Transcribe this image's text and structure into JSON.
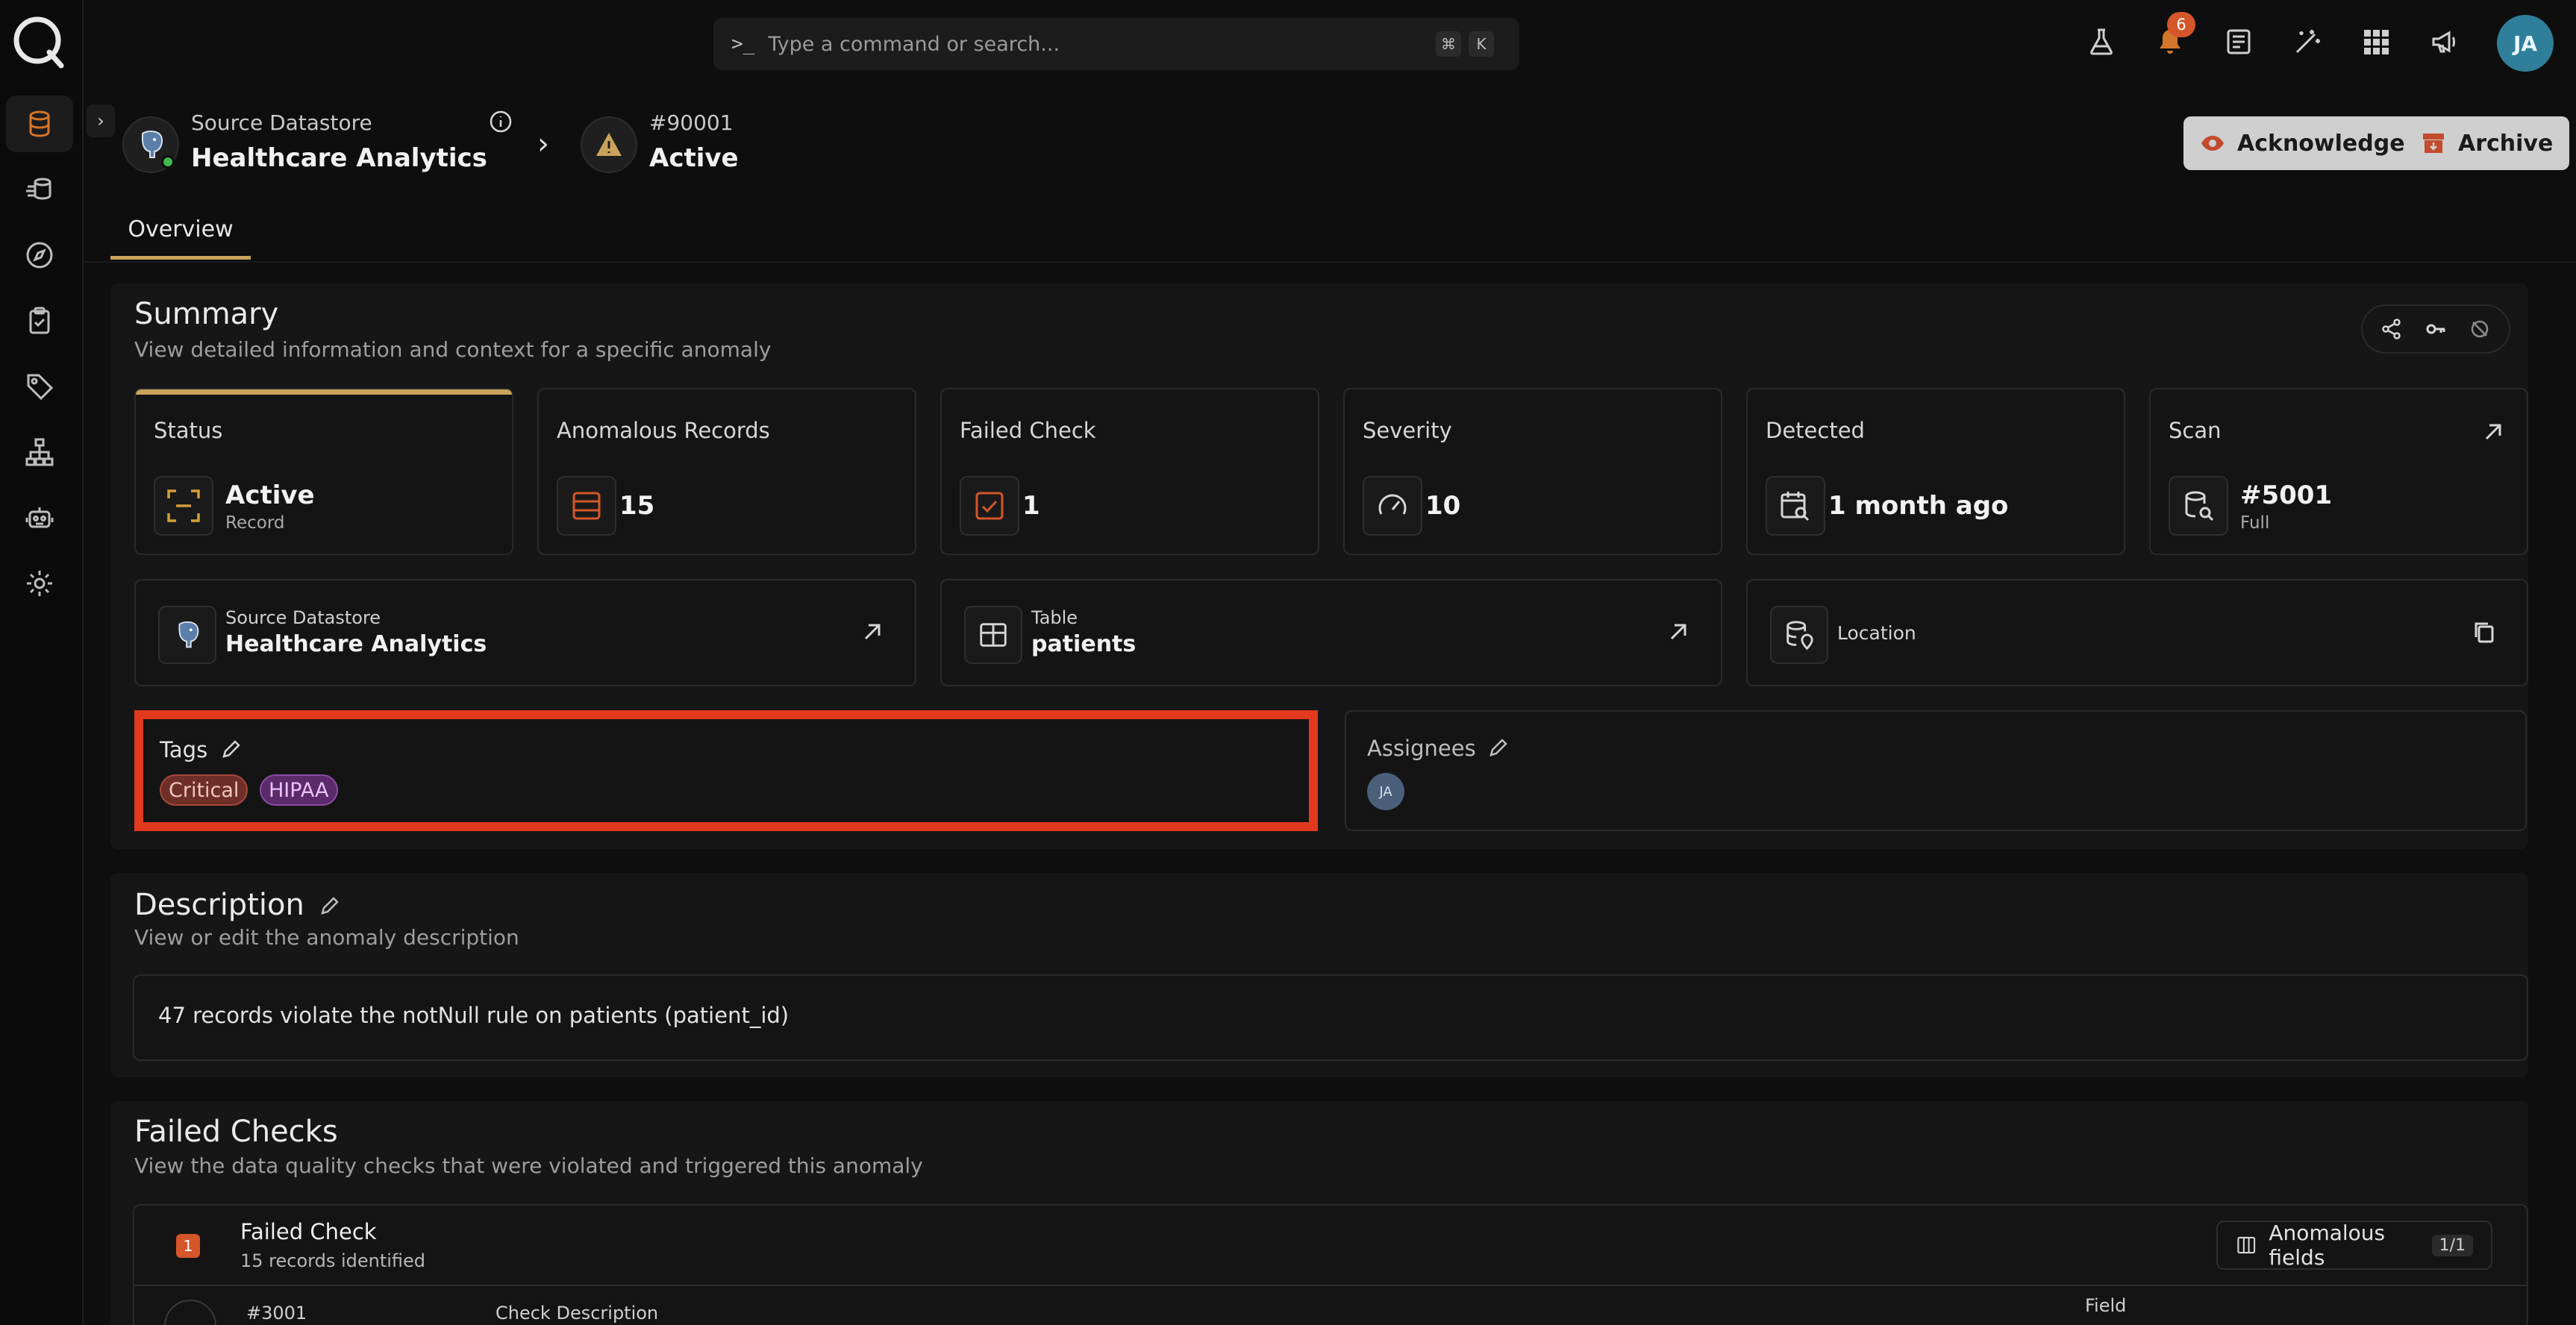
{
  "topbar": {
    "search_placeholder": "Type a command or search...",
    "shortcut_keys": [
      "⌘",
      "K"
    ],
    "notification_count": "6",
    "user_initials": "JA"
  },
  "breadcrumb": {
    "datastore_label": "Source Datastore",
    "datastore_name": "Healthcare Analytics",
    "anomaly_id": "#90001",
    "anomaly_status": "Active"
  },
  "actions": {
    "acknowledge": "Acknowledge",
    "archive": "Archive"
  },
  "tabs": [
    {
      "label": "Overview",
      "active": true
    }
  ],
  "summary": {
    "title": "Summary",
    "subtitle": "View detailed information and context for a specific anomaly",
    "cards": {
      "status": {
        "label": "Status",
        "value": "Active",
        "sub": "Record"
      },
      "anomalous_records": {
        "label": "Anomalous Records",
        "value": "15"
      },
      "failed_check": {
        "label": "Failed Check",
        "value": "1"
      },
      "severity": {
        "label": "Severity",
        "value": "10"
      },
      "detected": {
        "label": "Detected",
        "value": "1 month ago"
      },
      "scan": {
        "label": "Scan",
        "value": "#5001",
        "sub": "Full"
      }
    },
    "links": {
      "datastore": {
        "label": "Source Datastore",
        "value": "Healthcare Analytics"
      },
      "table": {
        "label": "Table",
        "value": "patients"
      },
      "location": {
        "label": "Location"
      }
    },
    "tags": {
      "label": "Tags",
      "items": [
        "Critical",
        "HIPAA"
      ]
    },
    "assignees": {
      "label": "Assignees",
      "initials": "JA"
    }
  },
  "description": {
    "title": "Description",
    "subtitle": "View or edit the anomaly description",
    "text": "47 records violate the notNull rule on patients (patient_id)"
  },
  "failed_checks": {
    "title": "Failed Checks",
    "subtitle": "View the data quality checks that were violated and triggered this anomaly",
    "count_badge": "1",
    "item_title": "Failed Check",
    "item_sub": "15 records identified",
    "anomalous_fields_label": "Anomalous fields",
    "anomalous_fields_count": "1/1",
    "row": {
      "check_id": "#3001",
      "col_description": "Check Description",
      "col_field": "Field"
    }
  },
  "colors": {
    "accent": "#c9a25b",
    "highlight": "#e2391f",
    "notification": "#d4562a",
    "icon_orange": "#d4762a"
  }
}
